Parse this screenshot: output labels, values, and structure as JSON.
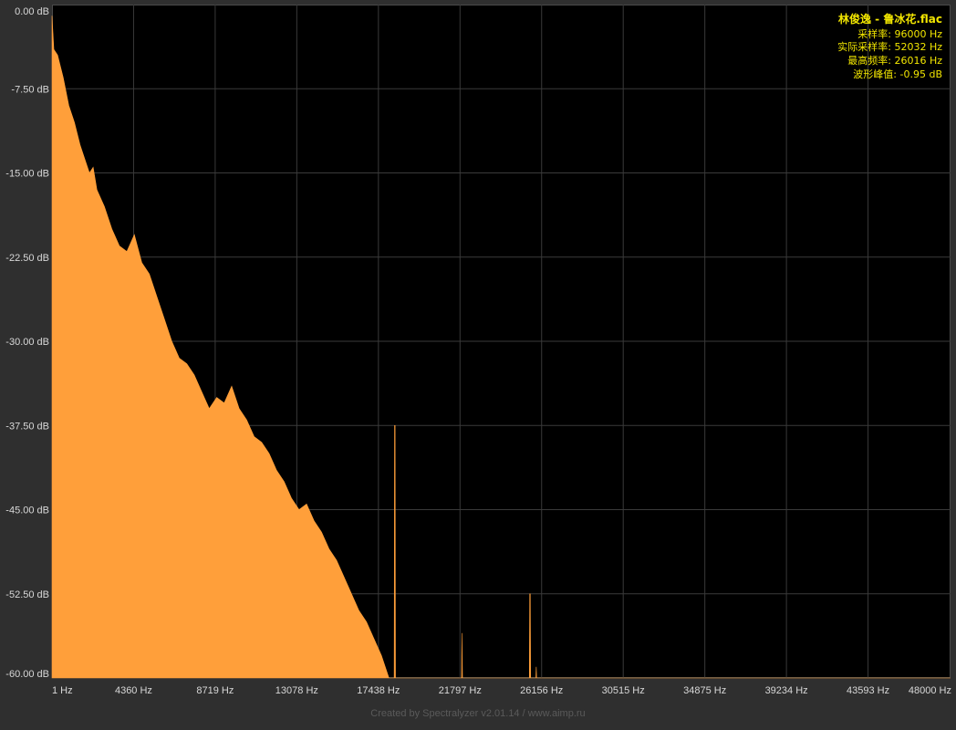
{
  "info": {
    "file": "林俊逸 - 鲁冰花.flac",
    "sample_rate": "采样率: 96000 Hz",
    "actual_sample_rate": "实际采样率: 52032 Hz",
    "max_frequency": "最高频率: 26016 Hz",
    "peak": "波形峰值: -0.95 dB"
  },
  "footer": "Created by Spectralyzer v2.01.14 / www.aimp.ru",
  "colors": {
    "fill": "#ff9f3a",
    "plot_background": "#000000",
    "grid": "#3a3a3a",
    "info_text": "#f2e600"
  },
  "chart_data": {
    "type": "area",
    "x_range": [
      1,
      48000
    ],
    "y_range": [
      -60,
      0
    ],
    "x_unit": "Hz",
    "y_unit": "dB",
    "grid": true,
    "x_tick_labels": [
      "1 Hz",
      "4360 Hz",
      "8719 Hz",
      "13078 Hz",
      "17438 Hz",
      "21797 Hz",
      "26156 Hz",
      "30515 Hz",
      "34875 Hz",
      "39234 Hz",
      "43593 Hz",
      "48000 Hz"
    ],
    "x_tick_values": [
      1,
      4360,
      8719,
      13078,
      17438,
      21797,
      26156,
      30515,
      34875,
      39234,
      43593,
      48000
    ],
    "y_tick_labels": [
      "0.00 dB",
      "-7.50 dB",
      "-15.00 dB",
      "-22.50 dB",
      "-30.00 dB",
      "-37.50 dB",
      "-45.00 dB",
      "-52.50 dB",
      "-60.00 dB"
    ],
    "y_tick_values": [
      0,
      -7.5,
      -15,
      -22.5,
      -30,
      -37.5,
      -45,
      -52.5,
      -60
    ],
    "series": [
      {
        "values": [
          [
            1,
            -1.0
          ],
          [
            100,
            -4.0
          ],
          [
            300,
            -4.5
          ],
          [
            600,
            -6.5
          ],
          [
            900,
            -9.0
          ],
          [
            1200,
            -10.5
          ],
          [
            1500,
            -12.5
          ],
          [
            1800,
            -14.0
          ],
          [
            2000,
            -15.0
          ],
          [
            2200,
            -14.5
          ],
          [
            2400,
            -16.5
          ],
          [
            2800,
            -18.0
          ],
          [
            3200,
            -20.0
          ],
          [
            3600,
            -21.5
          ],
          [
            4000,
            -22.0
          ],
          [
            4400,
            -20.5
          ],
          [
            4800,
            -23.0
          ],
          [
            5200,
            -24.0
          ],
          [
            5600,
            -26.0
          ],
          [
            6000,
            -28.0
          ],
          [
            6400,
            -30.0
          ],
          [
            6800,
            -31.5
          ],
          [
            7200,
            -32.0
          ],
          [
            7600,
            -33.0
          ],
          [
            8000,
            -34.5
          ],
          [
            8400,
            -36.0
          ],
          [
            8800,
            -35.0
          ],
          [
            9200,
            -35.5
          ],
          [
            9600,
            -34.0
          ],
          [
            10000,
            -36.0
          ],
          [
            10400,
            -37.0
          ],
          [
            10800,
            -38.5
          ],
          [
            11200,
            -39.0
          ],
          [
            11600,
            -40.0
          ],
          [
            12000,
            -41.5
          ],
          [
            12400,
            -42.5
          ],
          [
            12800,
            -44.0
          ],
          [
            13200,
            -45.0
          ],
          [
            13600,
            -44.5
          ],
          [
            14000,
            -46.0
          ],
          [
            14400,
            -47.0
          ],
          [
            14800,
            -48.5
          ],
          [
            15200,
            -49.5
          ],
          [
            15600,
            -51.0
          ],
          [
            16000,
            -52.5
          ],
          [
            16400,
            -54.0
          ],
          [
            16800,
            -55.0
          ],
          [
            17200,
            -56.5
          ],
          [
            17600,
            -58.0
          ],
          [
            18000,
            -60.0
          ],
          [
            18280,
            -60.0
          ],
          [
            18300,
            -37.5
          ],
          [
            18330,
            -37.5
          ],
          [
            18350,
            -60.0
          ],
          [
            21880,
            -60.0
          ],
          [
            21900,
            -56.0
          ],
          [
            21930,
            -60.0
          ],
          [
            25500,
            -60.0
          ],
          [
            25520,
            -52.5
          ],
          [
            25550,
            -52.5
          ],
          [
            25570,
            -60.0
          ],
          [
            25850,
            -60.0
          ],
          [
            25870,
            -59.0
          ],
          [
            25890,
            -60.0
          ],
          [
            48000,
            -60.0
          ]
        ]
      }
    ]
  }
}
